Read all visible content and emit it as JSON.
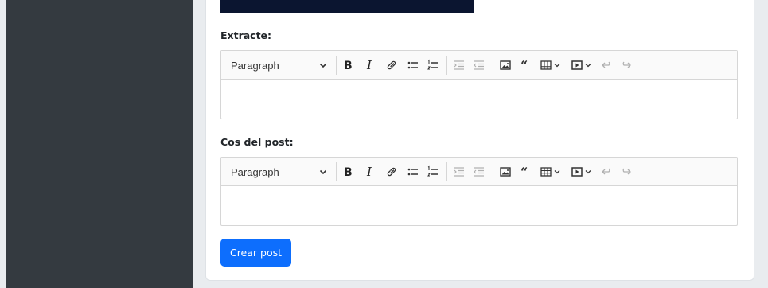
{
  "form": {
    "extract_label": "Extracte:",
    "body_label": "Cos del post:",
    "submit_label": "Crear post"
  },
  "editor_toolbar": {
    "heading_value": "Paragraph"
  },
  "colors": {
    "sidebar": "#343a40",
    "primary": "#0d6efd",
    "header_bar": "#0b1530"
  }
}
